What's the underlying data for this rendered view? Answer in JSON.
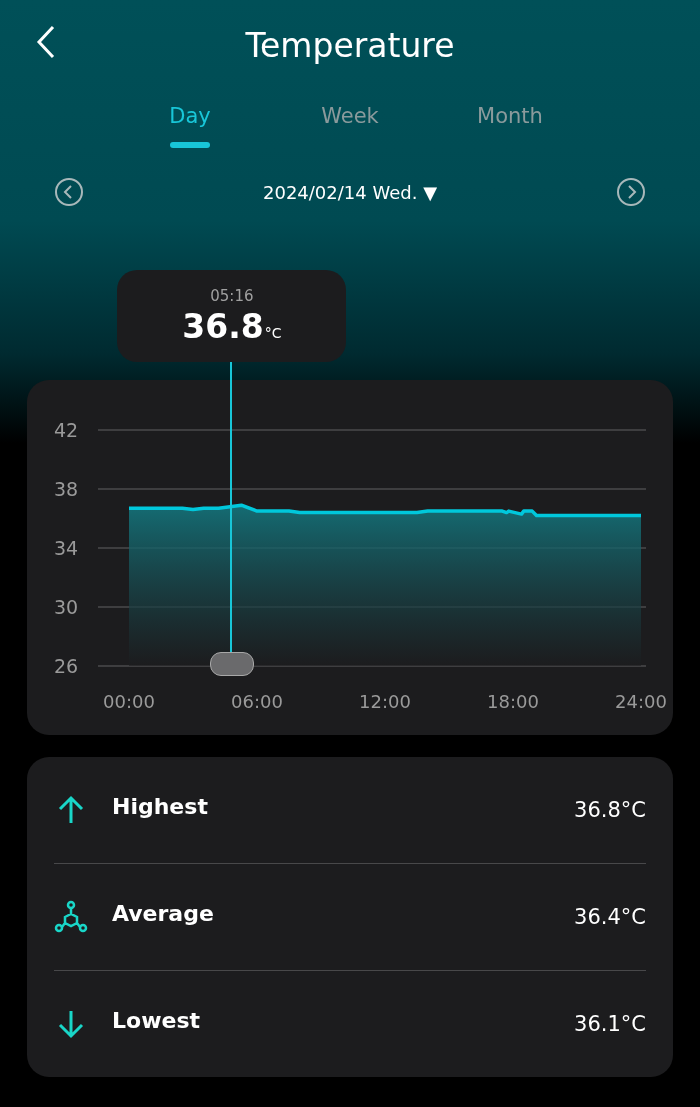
{
  "header": {
    "title": "Temperature"
  },
  "tabs": [
    {
      "label": "Day",
      "selected": true
    },
    {
      "label": "Week",
      "selected": false
    },
    {
      "label": "Month",
      "selected": false
    }
  ],
  "date_picker": {
    "label": "2024/02/14 Wed.",
    "caret": "▼"
  },
  "tooltip": {
    "time": "05:16",
    "value": "36.8",
    "unit": "°C"
  },
  "chart": {
    "chart_data": {
      "type": "area",
      "grid": true,
      "x": [
        0,
        2.5,
        3,
        3.5,
        4.2,
        5.27,
        6,
        7.5,
        8,
        13.5,
        14,
        17.5,
        17.7,
        17.8,
        18.4,
        18.5,
        18.9,
        19.1,
        24
      ],
      "series": [
        {
          "color": "#00c8dc",
          "values": [
            36.7,
            36.7,
            36.6,
            36.7,
            36.7,
            36.9,
            36.5,
            36.5,
            36.4,
            36.4,
            36.5,
            36.5,
            36.4,
            36.5,
            36.3,
            36.5,
            36.5,
            36.2,
            36.2
          ]
        }
      ],
      "xlim": [
        0,
        24
      ],
      "ylim": [
        26,
        42
      ],
      "xticks": [
        {
          "value": 0,
          "label": "00:00"
        },
        {
          "value": 6,
          "label": "06:00"
        },
        {
          "value": 12,
          "label": "12:00"
        },
        {
          "value": 18,
          "label": "18:00"
        },
        {
          "value": 24,
          "label": "24:00"
        }
      ],
      "yticks": [
        26,
        30,
        34,
        38,
        42
      ]
    }
  },
  "stats": [
    {
      "kind": "highest",
      "label": "Highest",
      "value": "36.8°C"
    },
    {
      "kind": "average",
      "label": "Average",
      "value": "36.4°C"
    },
    {
      "kind": "lowest",
      "label": "Lowest",
      "value": "36.1°C"
    }
  ]
}
